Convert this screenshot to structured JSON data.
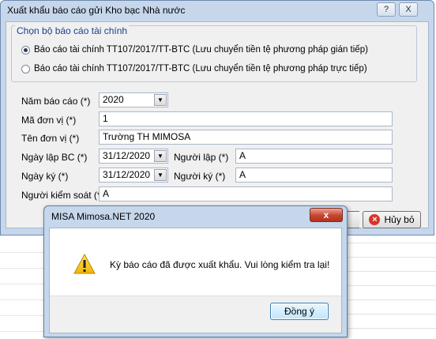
{
  "dialog": {
    "title": "Xuất khẩu báo cáo gửi Kho bạc Nhà nước",
    "group_label": "Chọn bộ báo cáo tài chính",
    "options": [
      {
        "label": "Báo cáo tài chính TT107/2017/TT-BTC (Lưu chuyển tiền tệ phương pháp gián tiếp)",
        "selected": true
      },
      {
        "label": "Báo cáo tài chính TT107/2017/TT-BTC (Lưu chuyển tiền tệ phương pháp trực tiếp)",
        "selected": false
      }
    ],
    "fields": {
      "nam_bao_cao_label": "Năm báo cáo (*)",
      "nam_bao_cao_value": "2020",
      "ma_don_vi_label": "Mã đơn vị (*)",
      "ma_don_vi_value": "1",
      "ten_don_vi_label": "Tên đơn vị (*)",
      "ten_don_vi_value": "Trường TH MIMOSA",
      "ngay_lap_label": "Ngày lập BC (*)",
      "ngay_lap_value": "31/12/2020",
      "nguoi_lap_label": "Người lập (*)",
      "nguoi_lap_value": "A",
      "ngay_ky_label": "Ngày ký (*)",
      "ngay_ky_value": "31/12/2020",
      "nguoi_ky_label": "Người ký (*)",
      "nguoi_ky_value": "A",
      "nguoi_kiem_soat_label": "Người kiểm soát (*)",
      "nguoi_kiem_soat_value": "A"
    },
    "cancel_label": "Hủy bỏ",
    "title_buttons": {
      "help": "?",
      "close": "X"
    }
  },
  "message_box": {
    "title": "MISA Mimosa.NET 2020",
    "close_glyph": "x",
    "text": "Kỳ báo cáo đã được xuất khẩu. Vui lòng kiểm tra lại!",
    "ok_label": "Đồng ý"
  },
  "colors": {
    "frame": "#c6d7ec",
    "body": "#f0f0f0",
    "close_red": "#c7432e",
    "cancel_icon": "#d9342b",
    "warning_yellow": "#f5c400"
  },
  "icons": [
    "help-icon",
    "close-icon",
    "cancel-icon",
    "warning-icon",
    "chevron-down-icon"
  ]
}
